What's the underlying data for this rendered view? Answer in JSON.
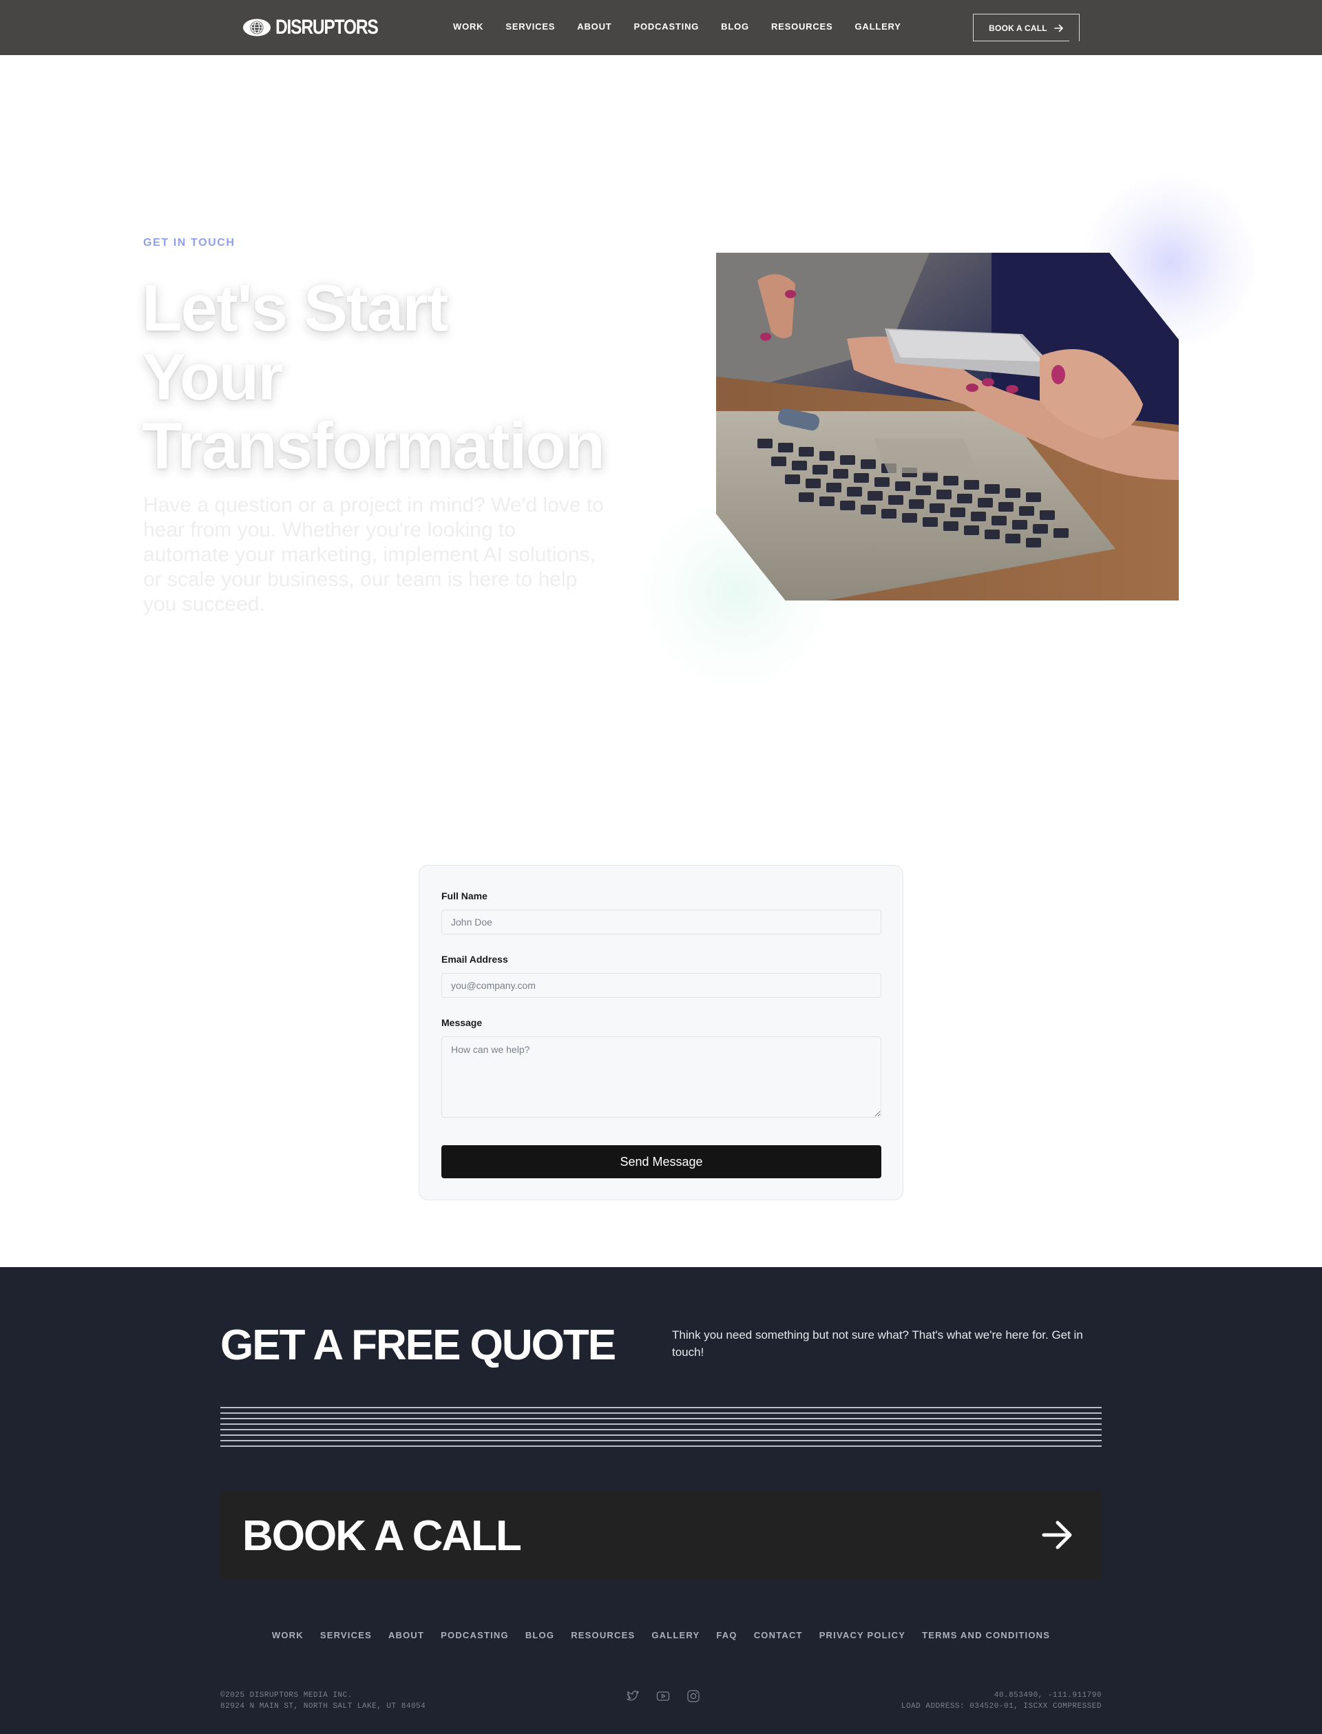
{
  "brand": {
    "name": "DISRUPTORS"
  },
  "nav": {
    "items": [
      "WORK",
      "SERVICES",
      "ABOUT",
      "PODCASTING",
      "BLOG",
      "RESOURCES",
      "GALLERY"
    ],
    "cta": "BOOK A CALL"
  },
  "hero": {
    "eyebrow": "GET IN TOUCH",
    "title_lines": [
      "Let's Start",
      "Your",
      "Transformation"
    ],
    "description": "Have a question or a project in mind? We'd love to hear from you. Whether you're looking to automate your marketing, implement AI solutions, or scale your business, our team is here to help you succeed."
  },
  "form": {
    "name_label": "Full Name",
    "name_placeholder": "John Doe",
    "email_label": "Email Address",
    "email_placeholder": "you@company.com",
    "message_label": "Message",
    "message_placeholder": "How can we help?",
    "submit_label": "Send Message"
  },
  "footer": {
    "quote_title": "GET A FREE QUOTE",
    "quote_text": "Think you need something but not sure what? That's what we're here for. Get in touch!",
    "cta_label": "BOOK A CALL",
    "links": [
      "WORK",
      "SERVICES",
      "ABOUT",
      "PODCASTING",
      "BLOG",
      "RESOURCES",
      "GALLERY",
      "FAQ",
      "CONTACT",
      "PRIVACY POLICY",
      "TERMS AND CONDITIONS"
    ],
    "copyright": "©2025 DISRUPTORS MEDIA INC.",
    "address": "82924 N MAIN ST, NORTH SALT LAKE, UT 84054",
    "coordinates": "40.853490, -111.911790",
    "load_address": "LOAD ADDRESS: 034520-01, ISCXX COMPRESSED",
    "social_icons": [
      "twitter-icon",
      "youtube-icon",
      "instagram-icon"
    ]
  },
  "colors": {
    "header_bg": "#474645",
    "eyebrow": "#8fa0ee",
    "footer_bg": "#1f2330",
    "cta_bg": "#222222",
    "button_dark": "#141414"
  }
}
